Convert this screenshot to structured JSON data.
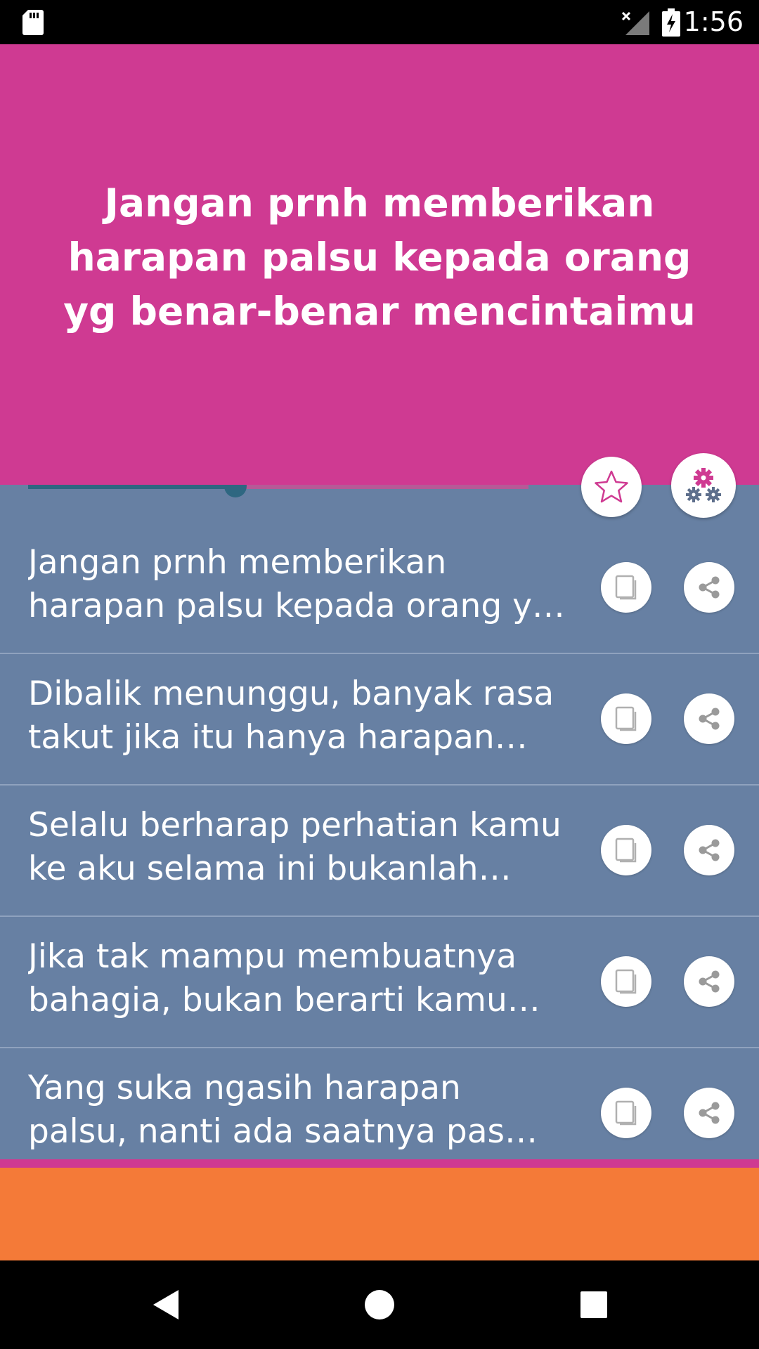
{
  "status_bar": {
    "time": "1:56",
    "icons": [
      "sd-card-icon",
      "signal-no-data-icon",
      "battery-charging-icon"
    ]
  },
  "header": {
    "quote": "Jangan prnh memberikan harapan palsu kepada orang yg benar-benar mencintaimu"
  },
  "slider": {
    "value_fraction": 0.415
  },
  "actions": {
    "favorites_icon": "star-icon",
    "settings_icon": "gears-icon"
  },
  "quotes": [
    {
      "text": "Jangan prnh memberikan harapan palsu kepada orang yg benar-benar mencintaimu"
    },
    {
      "text": "Dibalik menunggu, banyak rasa takut jika itu hanya harapan palsu"
    },
    {
      "text": "Selalu berharap perhatian kamu ke aku selama ini bukanlah harapan palsu"
    },
    {
      "text": "Jika tak mampu membuatnya bahagia, bukan berarti kamu boleh memberi harapan palsu"
    },
    {
      "text": "Yang suka ngasih harapan palsu, nanti ada saatnya pas sudah serius malah tidak dipercaya"
    }
  ],
  "item_icons": {
    "copy": "copy-icon",
    "share": "share-icon"
  },
  "colors": {
    "header_bg": "#cf3a92",
    "content_bg": "#6780a3",
    "slider_fill": "#2e6781",
    "ad_bg": "#f47a38",
    "icon_gray": "#b0b0b0",
    "icon_share_gray": "#9a9a9a"
  },
  "nav": {
    "icons": [
      "back-icon",
      "home-icon",
      "recents-icon"
    ]
  }
}
